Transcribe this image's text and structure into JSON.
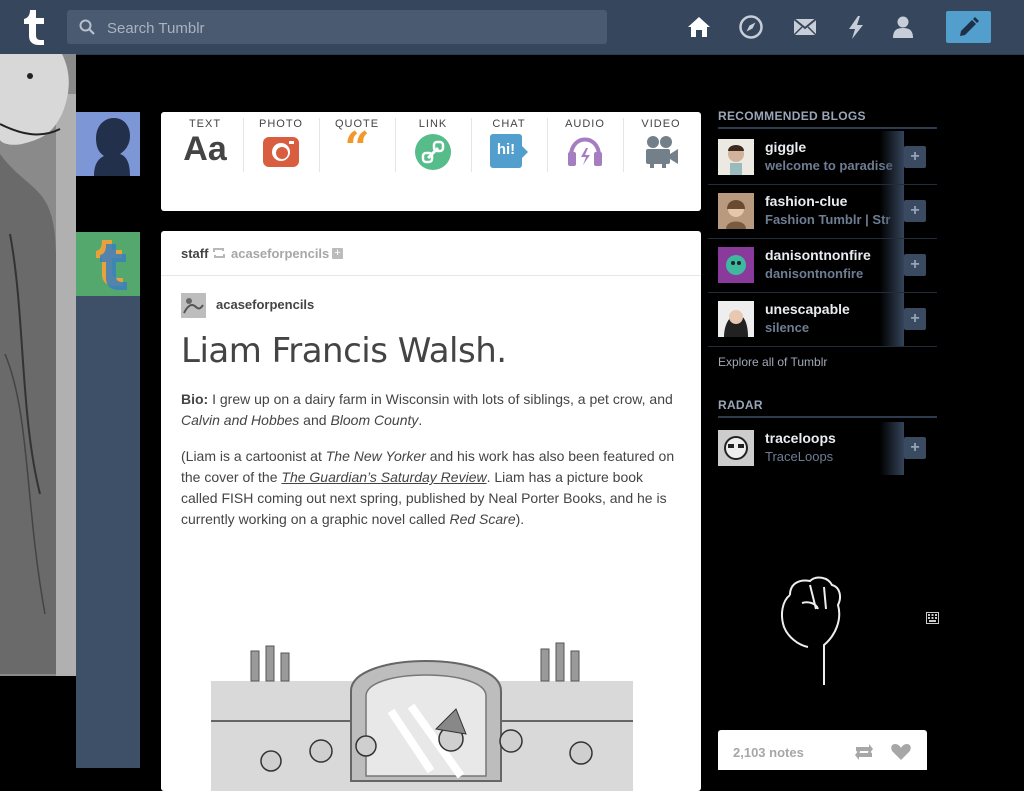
{
  "topbar": {
    "search_placeholder": "Search Tumblr",
    "nav_icons": [
      "home-icon",
      "explore-icon",
      "mail-icon",
      "activity-icon",
      "account-icon"
    ],
    "compose_icon": "pencil-icon"
  },
  "post_types": [
    {
      "label": "TEXT",
      "icon": "text-icon",
      "glyph": "Aa",
      "color": "#444444"
    },
    {
      "label": "PHOTO",
      "icon": "camera-icon",
      "color": "#d95e40"
    },
    {
      "label": "QUOTE",
      "icon": "quote-icon",
      "glyph": "66",
      "color": "#f2992e"
    },
    {
      "label": "LINK",
      "icon": "link-icon",
      "color": "#56bc8a"
    },
    {
      "label": "CHAT",
      "icon": "chat-icon",
      "glyph": "hi!",
      "color": "#529ecc"
    },
    {
      "label": "AUDIO",
      "icon": "headphones-icon",
      "color": "#a77dc2"
    },
    {
      "label": "VIDEO",
      "icon": "video-camera-icon",
      "color": "#748089"
    }
  ],
  "post": {
    "reblogger": "staff",
    "source": "acaseforpencils",
    "author": "acaseforpencils",
    "title": "Liam Francis Walsh.",
    "bio_label": "Bio:",
    "bio_text": " I grew up on a dairy farm in Wisconsin with lots of siblings, a pet crow, and ",
    "bio_em1": "Calvin and Hobbes",
    "bio_and": " and ",
    "bio_em2": "Bloom County",
    "bio_end": ".",
    "p2_a": "(Liam is a cartoonist at ",
    "p2_em1": "The New Yorker",
    "p2_b": " and his work has also been featured on the cover of the ",
    "p2_link": "The Guardian’s Saturday Review",
    "p2_c": ". Liam has a picture book called FISH coming out next spring, published by Neal Porter Books, and he is currently working on a graphic novel called ",
    "p2_em2": "Red Scare",
    "p2_d": ")."
  },
  "sidebar": {
    "recommended_title": "RECOMMENDED BLOGS",
    "blogs": [
      {
        "name": "giggle",
        "subtitle": "welcome to paradise"
      },
      {
        "name": "fashion-clue",
        "subtitle": "Fashion Tumblr | Str"
      },
      {
        "name": "danisontnonfire",
        "subtitle": "danisontnonfire"
      },
      {
        "name": "unescapable",
        "subtitle": "silence"
      }
    ],
    "explore_link": "Explore all of Tumblr",
    "radar_title": "RADAR",
    "radar_blog": {
      "name": "traceloops",
      "subtitle": "TraceLoops"
    },
    "notes_count": "2,103 notes"
  },
  "colors": {
    "topbar": "#36465d",
    "compose": "#529ecc",
    "background": "#000000"
  }
}
